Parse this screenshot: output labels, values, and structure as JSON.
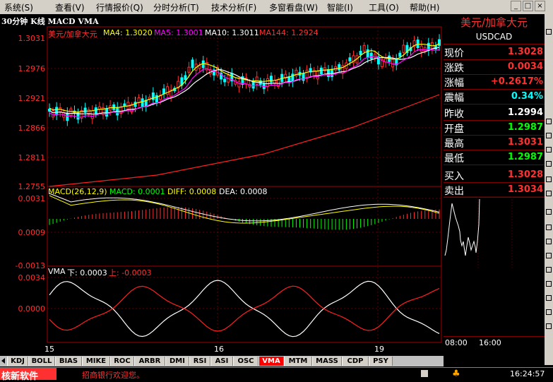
{
  "menu": [
    "系统(S)",
    "查看(V)",
    "行情报价(Q)",
    "分时分析(T)",
    "技术分析(F)",
    "多窗看盘(W)",
    "智能(I)",
    "工具(O)",
    "帮助(H)"
  ],
  "window_buttons": [
    "_",
    "□",
    "×"
  ],
  "chart_title": "30分钟 K线 MACD VMA",
  "main": {
    "symbol": "美元/加拿大元",
    "ma": [
      {
        "label": "MA4: 1.3020",
        "color": "#ffff00"
      },
      {
        "label": "MA5: 1.3001",
        "color": "#ff00ff"
      },
      {
        "label": "MA10: 1.3011",
        "color": "#ffffff"
      },
      {
        "label": "MA144: 1.2924",
        "color": "#ff3030"
      }
    ],
    "y_labels": [
      "1.3031",
      "1.2976",
      "1.2921",
      "1.2866",
      "1.2811",
      "1.2755"
    ]
  },
  "macd": {
    "title": "MACD(26,12,9)",
    "macd_val": "MACD: 0.0001",
    "diff": "DIFF: 0.0008",
    "dea": "DEA: 0.0008",
    "y_labels": [
      "0.0031",
      "0.0009",
      "-0.0013"
    ]
  },
  "vma": {
    "title": "VMA",
    "down": "下: 0.0003",
    "up": "上: -0.0003",
    "y_labels": [
      "0.0034",
      "0.0000"
    ]
  },
  "x_labels": [
    "15",
    "16",
    "19"
  ],
  "tabs": [
    "KDJ",
    "BOLL",
    "BIAS",
    "MIKE",
    "ROC",
    "ARBR",
    "DMI",
    "RSI",
    "ASI",
    "OSC",
    "VMA",
    "MTM",
    "MASS",
    "CDP",
    "PSY"
  ],
  "active_tab": "VMA",
  "quote": {
    "name": "美元/加拿大元",
    "code": "USDCAD",
    "rows": [
      {
        "label": "现价",
        "value": "1.3028",
        "color": "#ff3030"
      },
      {
        "label": "涨跌",
        "value": "0.0034",
        "color": "#ff3030"
      },
      {
        "label": "涨幅",
        "value": "+0.2617%",
        "color": "#ff3030"
      },
      {
        "label": "震幅",
        "value": "0.34%",
        "color": "#00ffff"
      },
      {
        "label": "昨收",
        "value": "1.2994",
        "color": "#ffffff"
      },
      {
        "label": "开盘",
        "value": "1.2987",
        "color": "#00ff00"
      },
      {
        "label": "最高",
        "value": "1.3031",
        "color": "#ff3030"
      },
      {
        "label": "最低",
        "value": "1.2987",
        "color": "#00ff00"
      },
      {
        "label": "买入",
        "value": "1.3028",
        "color": "#ff3030"
      },
      {
        "label": "卖出",
        "value": "1.3034",
        "color": "#ff3030"
      }
    ],
    "time_labels": [
      "08:00",
      "16:00"
    ]
  },
  "status": {
    "brand": "核新软件",
    "ticker": "招商银行欢迎您。",
    "time": "16:24:57"
  }
}
